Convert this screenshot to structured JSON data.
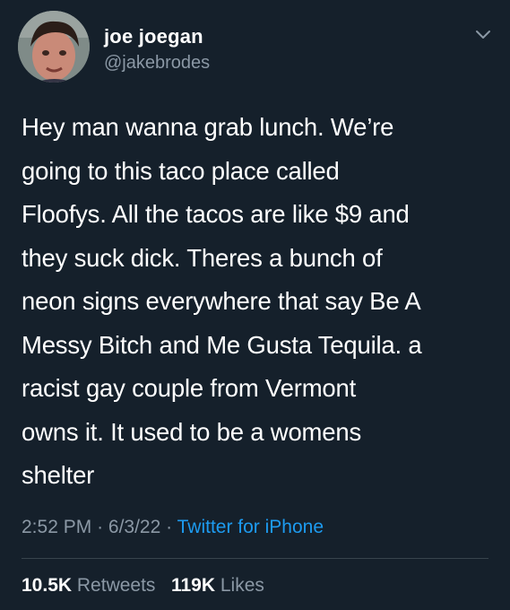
{
  "user": {
    "display_name": "joe joegan",
    "handle": "@jakebrodes"
  },
  "tweet": {
    "text": "Hey man wanna grab lunch. We’re\ngoing to this taco place called\nFloofys. All the tacos are like $9 and\nthey suck dick. Theres a bunch of\nneon signs everywhere that say Be A\nMessy Bitch and Me Gusta Tequila. a\nracist gay couple from Vermont\nowns it. It used to be a womens\nshelter",
    "time": "2:52 PM",
    "date": "6/3/22",
    "separator": "·",
    "source": "Twitter for iPhone"
  },
  "stats": {
    "retweets_count": "10.5K",
    "retweets_label": "Retweets",
    "likes_count": "119K",
    "likes_label": "Likes"
  },
  "colors": {
    "background": "#15202b",
    "text_primary": "#ffffff",
    "text_secondary": "#8b98a5",
    "link": "#1d9bf0",
    "divider": "#38444d"
  },
  "icons": {
    "menu": "chevron-down-icon"
  }
}
